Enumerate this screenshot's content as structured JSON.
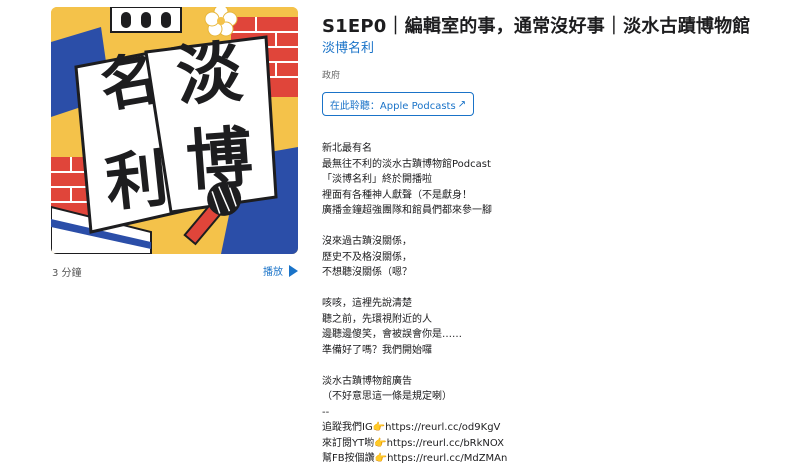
{
  "episode": {
    "title": "S1EP0｜編輯室的事，通常沒好事｜淡水古蹟博物館",
    "show_name": "淡博名利",
    "category": "政府",
    "listen_button_label": "在此聆聽：Apple Podcasts",
    "duration": "3 分鐘",
    "play_label": "播放"
  },
  "artwork": {
    "chars": [
      "名",
      "利",
      "淡",
      "博"
    ]
  },
  "description": {
    "block1": [
      "新北最有名",
      "最無往不利的淡水古蹟博物館Podcast",
      "「淡博名利」終於開播啦",
      "裡面有各種神人獻聲（不是獻身！",
      "廣播金鐘超強團隊和館員們都來參一腳"
    ],
    "block2": [
      "沒來過古蹟沒關係，",
      "歷史不及格沒關係，",
      "不想聽沒關係（嗯？"
    ],
    "block3": [
      "咳咳，這裡先說清楚",
      "聽之前，先環視附近的人",
      "邊聽邊傻笑，會被誤會你是……",
      "準備好了嗎？我們開始囉"
    ],
    "block4": [
      "淡水古蹟博物館廣告",
      "（不好意思這一條是規定喇）",
      "--",
      "追蹤我們IG👉https://reurl.cc/od9KgV",
      "來訂閱YT喲👉https://reurl.cc/bRkNOX",
      "幫FB按個讚👉https://reurl.cc/MdZMAn"
    ]
  },
  "colors": {
    "accent": "#1a73c8",
    "art_yellow": "#f4c24a",
    "art_blue": "#2b4ea8",
    "art_red": "#e0453a"
  }
}
